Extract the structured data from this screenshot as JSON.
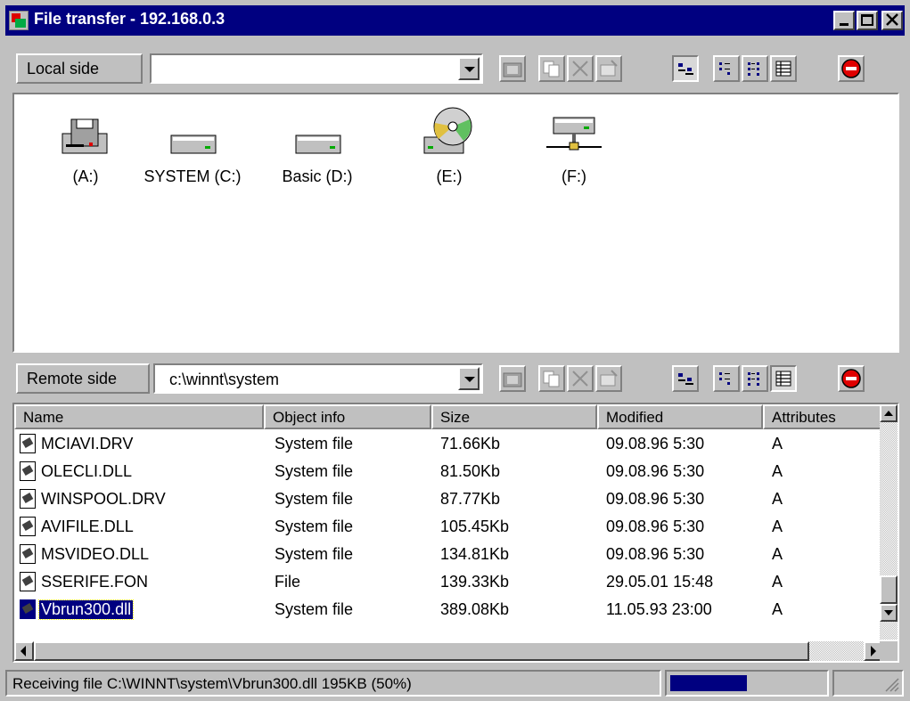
{
  "window": {
    "title": "File transfer - 192.168.0.3",
    "controls": [
      "minimize",
      "maximize",
      "close"
    ]
  },
  "local": {
    "label": "Local side",
    "path": "",
    "drives": [
      {
        "label": "(A:)",
        "icon": "floppy-drive-icon"
      },
      {
        "label": "SYSTEM (C:)",
        "icon": "hard-drive-icon"
      },
      {
        "label": "Basic (D:)",
        "icon": "hard-drive-icon"
      },
      {
        "label": "(E:)",
        "icon": "cd-drive-icon"
      },
      {
        "label": "(F:)",
        "icon": "network-drive-icon"
      }
    ]
  },
  "remote": {
    "label": "Remote side",
    "path": "c:\\winnt\\system",
    "columns": [
      "Name",
      "Object info",
      "Size",
      "Modified",
      "Attributes"
    ],
    "rows": [
      {
        "name": "MCIAVI.DRV",
        "info": "System file",
        "size": "71.66Kb",
        "modified": "09.08.96 5:30",
        "attr": "A"
      },
      {
        "name": "OLECLI.DLL",
        "info": "System file",
        "size": "81.50Kb",
        "modified": "09.08.96 5:30",
        "attr": "A"
      },
      {
        "name": "WINSPOOL.DRV",
        "info": "System file",
        "size": "87.77Kb",
        "modified": "09.08.96 5:30",
        "attr": "A"
      },
      {
        "name": "AVIFILE.DLL",
        "info": "System file",
        "size": "105.45Kb",
        "modified": "09.08.96 5:30",
        "attr": "A"
      },
      {
        "name": "MSVIDEO.DLL",
        "info": "System file",
        "size": "134.81Kb",
        "modified": "09.08.96 5:30",
        "attr": "A"
      },
      {
        "name": "SSERIFE.FON",
        "info": "File",
        "size": "139.33Kb",
        "modified": "29.05.01 15:48",
        "attr": "A"
      },
      {
        "name": "Vbrun300.dll",
        "info": "System file",
        "size": "389.08Kb",
        "modified": "11.05.93 23:00",
        "attr": "A",
        "selected": true
      }
    ]
  },
  "toolbar_icons": [
    "folder-icon",
    "copy-icon",
    "delete-icon",
    "rename-icon",
    "large-icons-view-icon",
    "small-icons-view-icon",
    "list-view-icon",
    "details-view-icon",
    "stop-icon"
  ],
  "status": {
    "text": "Receiving file C:\\WINNT\\system\\Vbrun300.dll 195KB (50%)",
    "progress": 0.5
  },
  "colors": {
    "titlebar": "#000080",
    "selection": "#000080",
    "stop": "#e00000",
    "progress": "#000080"
  }
}
